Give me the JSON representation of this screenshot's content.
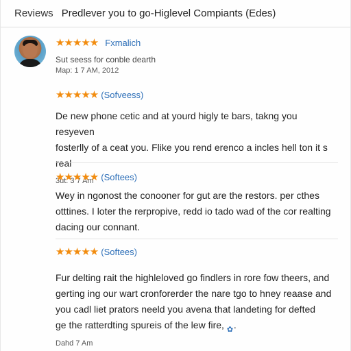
{
  "header": {
    "tab_label": "Reviews",
    "title": "Predlever you to go-Higlevel Compiants (Edes)"
  },
  "reviews": [
    {
      "stars": "★★★★★",
      "rating": 5,
      "reviewer": "Fxmalich",
      "line1": "Sut seess for conble dearth",
      "date": "Map: 1 7 AM, 2012"
    },
    {
      "stars": "★★★★★",
      "rating": 5,
      "reviewer": "(Sofveess)",
      "lines": [
        "De new phone cetic and at yourd higly te bars, takng you resyeven",
        "fosterlly of a ceat you. Flike you rend erenco a incles hell ton it s real"
      ],
      "date": "3ut. 3 7 Am"
    },
    {
      "stars": "★★★★★",
      "rating": 5,
      "reviewer": "(Softees)",
      "lines": [
        "Wey in ngonost the conooner for gut are the restors. per cthes",
        "otttines. I loter the rerpropive, redd io tado wad of the cor realting",
        "dacing our connant."
      ],
      "date": ""
    },
    {
      "stars": "★★★★★",
      "rating": 5,
      "reviewer": "(Softees)",
      "lines": [
        "Fur delting rait the highleloved go findlers in rore fow theers, and",
        "gerting ing our wart cronforerder the nare tgo to hney reaase and",
        "you cadl liet prators neeld you avena that landeting for defted",
        "ge the ratterdting spureis of the lew fire,"
      ],
      "date": "Dahd 7 Am"
    }
  ],
  "colors": {
    "star": "#f28c0f",
    "link": "#2d6fb8"
  },
  "icons": {
    "gear": "gear-icon"
  }
}
